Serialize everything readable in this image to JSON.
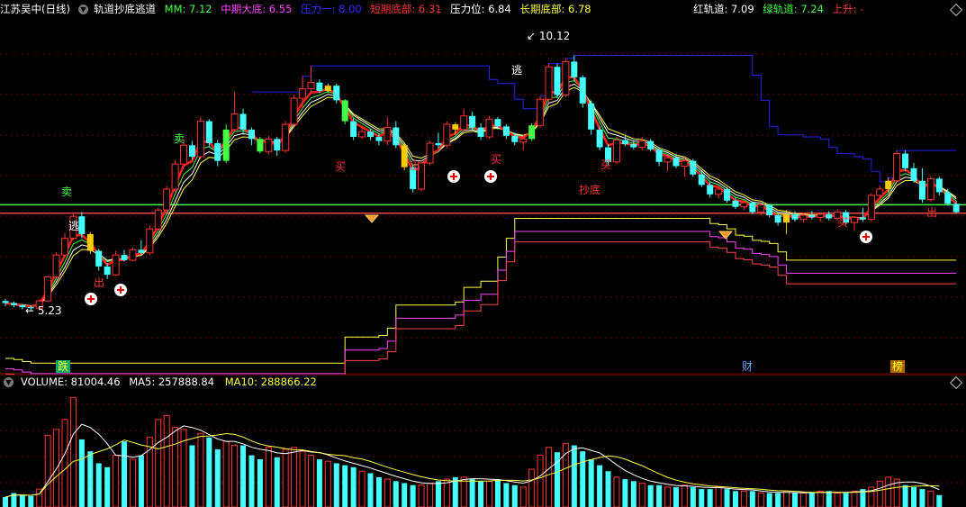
{
  "header": {
    "stock": "江苏吴中(日线)",
    "indicator": "轨道抄底逃道",
    "mm": {
      "label": "MM: 7.12",
      "color": "#ffffff"
    },
    "items": [
      {
        "key": "mid_bottom",
        "text": "中期大底: 6.55",
        "color": "#ff44ff"
      },
      {
        "key": "pressure1",
        "text": "压力一: 8.00",
        "color": "#3030ff"
      },
      {
        "key": "short_bottom",
        "text": "短期底部: 6.31",
        "color": "#ff3333"
      },
      {
        "key": "pressure",
        "text": "压力位: 6.84",
        "color": "#ffffff"
      },
      {
        "key": "long_bottom",
        "text": "长期底部: 6.78",
        "color": "#ffff44"
      }
    ],
    "right_items": [
      {
        "key": "red_track",
        "text": "红轨道: 7.09",
        "color": "#ffffff"
      },
      {
        "key": "green_track",
        "text": "绿轨道: 7.24",
        "color": "#44ff44"
      },
      {
        "key": "rise",
        "text": "上升: -",
        "color": "#ff3333"
      }
    ]
  },
  "volume_header": {
    "volume": "VOLUME: 81004.46",
    "ma5": "MA5: 257888.84",
    "ma10": "MA10: 288866.22"
  },
  "signals": {
    "escape": "逃",
    "sell": "卖",
    "buy": "买",
    "exit": "出",
    "bottom_buy": "抄底",
    "fall": "跌",
    "wealth": "财",
    "rank": "榜"
  },
  "price_labels": {
    "high": "10.12",
    "low": "5.23"
  },
  "colors": {
    "up": "#ff3333",
    "down": "#44ffff",
    "gold": "#ffcc00",
    "green_candle": "#44ff44",
    "sell_line": "#44ff44",
    "pressure_line": "#ff4444",
    "blue_line": "#2222ee",
    "magenta_line": "#ff44ff",
    "white_line": "#ffffff",
    "yellow_line": "#ffff44"
  },
  "chart_data": {
    "type": "candlestick",
    "ylim": [
      4.2,
      10.8
    ],
    "sell_line": 7.26,
    "pressure_line": 7.1,
    "candles": [
      [
        5.42,
        5.46,
        5.32,
        5.38
      ],
      [
        5.38,
        5.41,
        5.3,
        5.34
      ],
      [
        5.34,
        5.36,
        5.26,
        5.3
      ],
      [
        5.3,
        5.33,
        5.23,
        5.28
      ],
      [
        5.28,
        5.45,
        5.26,
        5.42
      ],
      [
        5.42,
        5.9,
        5.4,
        5.88
      ],
      [
        5.88,
        6.35,
        5.86,
        6.3
      ],
      [
        6.3,
        6.72,
        6.28,
        6.62
      ],
      [
        6.62,
        7.1,
        6.58,
        7.04
      ],
      [
        7.04,
        7.12,
        6.62,
        6.7
      ],
      [
        6.7,
        6.74,
        6.32,
        6.38
      ],
      [
        6.38,
        6.42,
        6.0,
        6.08
      ],
      [
        6.08,
        6.14,
        5.84,
        5.92
      ],
      [
        5.92,
        6.38,
        5.9,
        6.3
      ],
      [
        6.3,
        6.4,
        6.18,
        6.2
      ],
      [
        6.2,
        6.44,
        6.18,
        6.4
      ],
      [
        6.4,
        6.58,
        6.3,
        6.34
      ],
      [
        6.34,
        6.86,
        6.3,
        6.8
      ],
      [
        6.8,
        7.2,
        6.76,
        7.16
      ],
      [
        7.16,
        7.62,
        7.12,
        7.56
      ],
      [
        7.56,
        8.12,
        7.5,
        8.04
      ],
      [
        8.04,
        8.52,
        8.0,
        8.4
      ],
      [
        8.4,
        8.48,
        8.12,
        8.18
      ],
      [
        8.18,
        8.94,
        8.14,
        8.86
      ],
      [
        8.86,
        8.9,
        8.36,
        8.44
      ],
      [
        8.44,
        8.5,
        8.0,
        8.1
      ],
      [
        8.1,
        8.8,
        8.06,
        8.7
      ],
      [
        8.7,
        9.42,
        8.66,
        9.0
      ],
      [
        9.0,
        9.1,
        8.6,
        8.7
      ],
      [
        8.7,
        8.74,
        8.4,
        8.52
      ],
      [
        8.52,
        8.56,
        8.24,
        8.28
      ],
      [
        8.28,
        8.58,
        8.22,
        8.52
      ],
      [
        8.52,
        8.56,
        8.2,
        8.3
      ],
      [
        8.3,
        8.86,
        8.26,
        8.8
      ],
      [
        8.8,
        9.36,
        8.76,
        9.3
      ],
      [
        9.3,
        9.72,
        9.1,
        9.48
      ],
      [
        9.48,
        9.92,
        9.4,
        9.6
      ],
      [
        9.6,
        9.66,
        9.4,
        9.44
      ],
      [
        9.44,
        9.58,
        9.4,
        9.54
      ],
      [
        9.54,
        9.58,
        9.2,
        9.26
      ],
      [
        9.26,
        9.28,
        8.8,
        8.86
      ],
      [
        8.86,
        8.92,
        8.5,
        8.56
      ],
      [
        8.56,
        8.72,
        8.52,
        8.66
      ],
      [
        8.66,
        8.72,
        8.5,
        8.56
      ],
      [
        8.56,
        8.62,
        8.4,
        8.48
      ],
      [
        8.48,
        8.94,
        8.4,
        8.74
      ],
      [
        8.74,
        8.86,
        8.34,
        8.4
      ],
      [
        8.4,
        8.44,
        7.92,
        7.98
      ],
      [
        7.98,
        8.02,
        7.5,
        7.56
      ],
      [
        7.56,
        8.12,
        7.52,
        8.06
      ],
      [
        8.06,
        8.48,
        8.02,
        8.44
      ],
      [
        8.44,
        8.64,
        8.34,
        8.4
      ],
      [
        8.4,
        8.86,
        8.34,
        8.8
      ],
      [
        8.8,
        8.84,
        8.6,
        8.7
      ],
      [
        8.7,
        9.1,
        8.66,
        8.96
      ],
      [
        8.96,
        9.04,
        8.7,
        8.74
      ],
      [
        8.74,
        8.82,
        8.5,
        8.56
      ],
      [
        8.56,
        8.96,
        8.52,
        8.9
      ],
      [
        8.9,
        8.94,
        8.7,
        8.76
      ],
      [
        8.76,
        8.8,
        8.52,
        8.58
      ],
      [
        8.58,
        8.64,
        8.4,
        8.46
      ],
      [
        8.46,
        8.6,
        8.3,
        8.52
      ],
      [
        8.52,
        8.82,
        8.48,
        8.78
      ],
      [
        8.78,
        9.34,
        8.74,
        9.28
      ],
      [
        9.28,
        9.96,
        9.2,
        9.9
      ],
      [
        9.9,
        9.96,
        9.3,
        9.36
      ],
      [
        9.36,
        10.06,
        9.32,
        10.0
      ],
      [
        10.0,
        10.12,
        9.62,
        9.7
      ],
      [
        9.7,
        9.74,
        9.12,
        9.2
      ],
      [
        9.2,
        9.26,
        8.6,
        8.7
      ],
      [
        8.7,
        8.76,
        8.3,
        8.36
      ],
      [
        8.36,
        8.42,
        8.0,
        8.08
      ],
      [
        8.08,
        8.56,
        8.04,
        8.5
      ],
      [
        8.5,
        8.6,
        8.38,
        8.42
      ],
      [
        8.42,
        8.5,
        8.32,
        8.36
      ],
      [
        8.36,
        8.56,
        8.3,
        8.48
      ],
      [
        8.48,
        8.52,
        8.28,
        8.32
      ],
      [
        8.32,
        8.36,
        8.0,
        8.08
      ],
      [
        8.08,
        8.2,
        7.9,
        8.16
      ],
      [
        8.16,
        8.24,
        7.96,
        8.0
      ],
      [
        8.0,
        8.18,
        7.8,
        8.1
      ],
      [
        8.1,
        8.14,
        7.8,
        7.84
      ],
      [
        7.84,
        7.9,
        7.6,
        7.64
      ],
      [
        7.64,
        7.7,
        7.4,
        7.46
      ],
      [
        7.46,
        7.62,
        7.38,
        7.56
      ],
      [
        7.56,
        7.6,
        7.3,
        7.34
      ],
      [
        7.34,
        7.4,
        7.18,
        7.22
      ],
      [
        7.22,
        7.34,
        7.16,
        7.3
      ],
      [
        7.3,
        7.32,
        7.08,
        7.12
      ],
      [
        7.12,
        7.3,
        7.06,
        7.26
      ],
      [
        7.26,
        7.28,
        7.02,
        7.06
      ],
      [
        7.06,
        7.1,
        6.86,
        6.92
      ],
      [
        6.92,
        7.16,
        6.7,
        7.08
      ],
      [
        7.08,
        7.14,
        6.94,
        6.98
      ],
      [
        6.98,
        7.1,
        6.92,
        7.06
      ],
      [
        7.06,
        7.14,
        6.98,
        7.02
      ],
      [
        7.02,
        7.1,
        6.94,
        7.08
      ],
      [
        7.08,
        7.14,
        6.96,
        7.0
      ],
      [
        7.0,
        7.18,
        6.96,
        7.12
      ],
      [
        7.12,
        7.16,
        6.88,
        6.92
      ],
      [
        6.92,
        7.04,
        6.76,
        7.02
      ],
      [
        7.02,
        7.2,
        6.94,
        6.98
      ],
      [
        6.98,
        7.48,
        6.94,
        7.44
      ],
      [
        7.44,
        7.62,
        7.38,
        7.56
      ],
      [
        7.56,
        7.78,
        7.5,
        7.72
      ],
      [
        7.72,
        8.3,
        7.68,
        8.24
      ],
      [
        8.24,
        8.3,
        7.9,
        7.96
      ],
      [
        7.96,
        8.06,
        7.68,
        7.72
      ],
      [
        7.72,
        7.96,
        7.3,
        7.36
      ],
      [
        7.36,
        7.8,
        7.32,
        7.76
      ],
      [
        7.76,
        7.8,
        7.44,
        7.5
      ],
      [
        7.5,
        7.56,
        7.24,
        7.28
      ],
      [
        7.28,
        7.34,
        7.1,
        7.12
      ]
    ],
    "volumes": [
      10,
      14,
      12,
      11,
      18,
      72,
      78,
      88,
      110,
      68,
      56,
      44,
      40,
      52,
      66,
      48,
      52,
      70,
      88,
      92,
      80,
      78,
      62,
      74,
      70,
      58,
      66,
      62,
      62,
      52,
      48,
      60,
      50,
      58,
      60,
      56,
      52,
      48,
      46,
      44,
      42,
      40,
      36,
      34,
      30,
      28,
      26,
      24,
      22,
      22,
      24,
      26,
      28,
      30,
      30,
      28,
      26,
      26,
      28,
      24,
      22,
      20,
      38,
      52,
      60,
      55,
      64,
      62,
      56,
      48,
      42,
      36,
      30,
      28,
      26,
      24,
      22,
      22,
      20,
      20,
      22,
      20,
      18,
      18,
      20,
      18,
      16,
      16,
      16,
      14,
      14,
      14,
      16,
      14,
      14,
      14,
      16,
      16,
      14,
      14,
      16,
      18,
      20,
      26,
      30,
      28,
      22,
      20,
      18,
      16,
      12
    ]
  }
}
